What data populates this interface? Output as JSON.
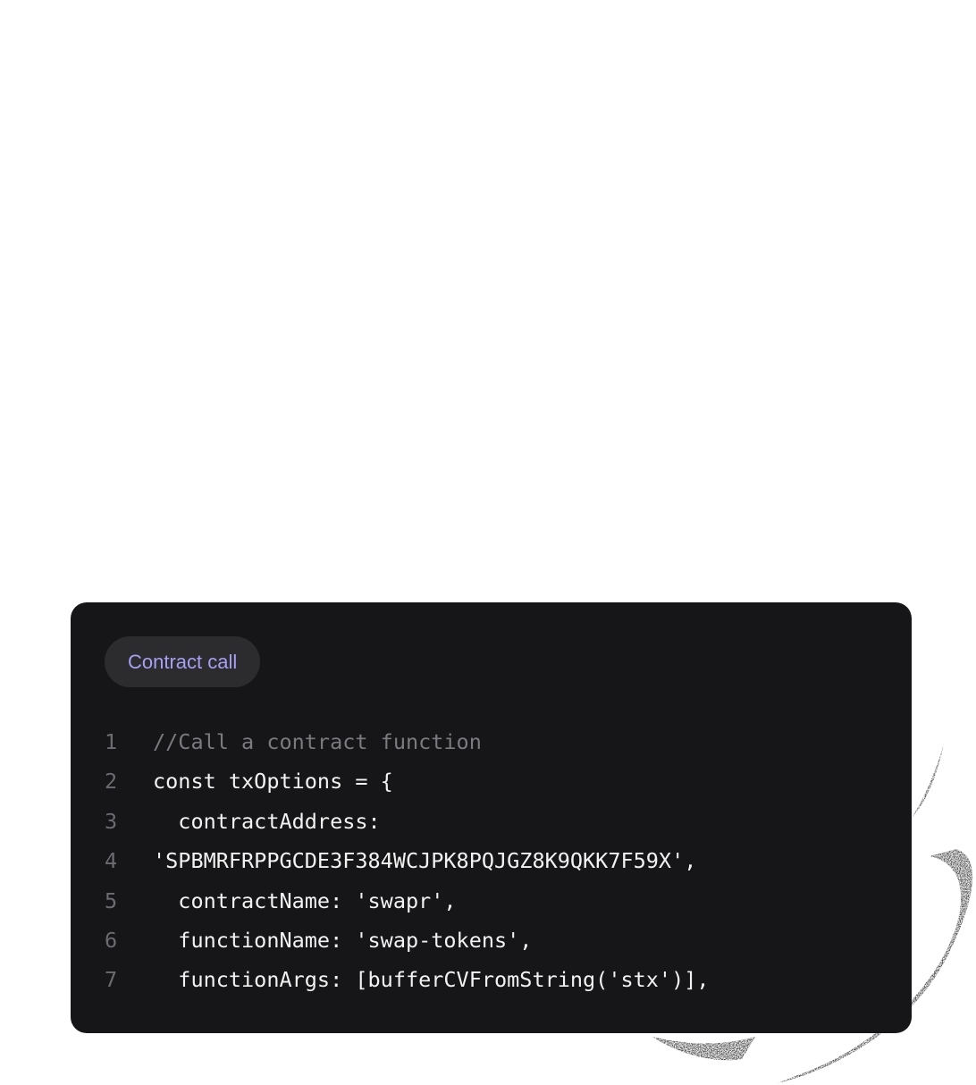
{
  "snippet": {
    "tag_label": "Contract call",
    "lines": [
      {
        "number": "1",
        "text": "//Call a contract function",
        "kind": "comment"
      },
      {
        "number": "2",
        "text": "const txOptions = {",
        "kind": "code"
      },
      {
        "number": "3",
        "text": "  contractAddress:",
        "kind": "code"
      },
      {
        "number": "4",
        "text": "'SPBMRFRPPGCDE3F384WCJPK8PQJGZ8K9QKK7F59X',",
        "kind": "code"
      },
      {
        "number": "5",
        "text": "  contractName: 'swapr',",
        "kind": "code"
      },
      {
        "number": "6",
        "text": "  functionName: 'swap-tokens',",
        "kind": "code"
      },
      {
        "number": "7",
        "text": "  functionArgs: [bufferCVFromString('stx')],",
        "kind": "code"
      }
    ]
  },
  "colors": {
    "card_background": "#161618",
    "tag_background": "#2c2c2f",
    "tag_text": "#a79ff3",
    "line_number": "#6b6b70",
    "code_text": "#f2f2f2",
    "comment_text": "#7a7a7f"
  }
}
